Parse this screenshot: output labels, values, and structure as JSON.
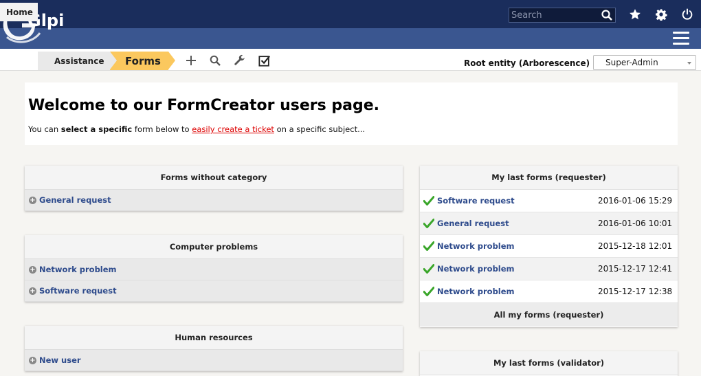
{
  "header": {
    "logo_text": "Glpi",
    "search_placeholder": "Search"
  },
  "breadcrumb": {
    "home": "Home",
    "assistance": "Assistance",
    "forms": "Forms"
  },
  "entity": {
    "label": "Root entity (Arborescence)",
    "profile": "Super-Admin"
  },
  "welcome": {
    "title": "Welcome to our FormCreator users page.",
    "text_1": "You can ",
    "text_bold": "select a specific",
    "text_2": " form below to ",
    "text_link": "easily create a ticket",
    "text_3": " on a specific subject..."
  },
  "categories": [
    {
      "title": "Forms without category",
      "forms": [
        "General request"
      ]
    },
    {
      "title": "Computer problems",
      "forms": [
        "Network problem",
        "Software request"
      ]
    },
    {
      "title": "Human resources",
      "forms": [
        "New user"
      ]
    }
  ],
  "last_requester": {
    "title": "My last forms (requester)",
    "rows": [
      {
        "name": "Software request",
        "date": "2016-01-06 15:29"
      },
      {
        "name": "General request",
        "date": "2016-01-06 10:01"
      },
      {
        "name": "Network problem",
        "date": "2015-12-18 12:01"
      },
      {
        "name": "Network problem",
        "date": "2015-12-17 12:41"
      },
      {
        "name": "Network problem",
        "date": "2015-12-17 12:38"
      }
    ],
    "all_label": "All my forms (requester)"
  },
  "last_validator": {
    "title": "My last forms (validator)"
  },
  "colors": {
    "top": "#1a2d5c",
    "blue": "#3a5690",
    "forms_tab": "#fbc85e",
    "link": "#2e4b8c"
  }
}
